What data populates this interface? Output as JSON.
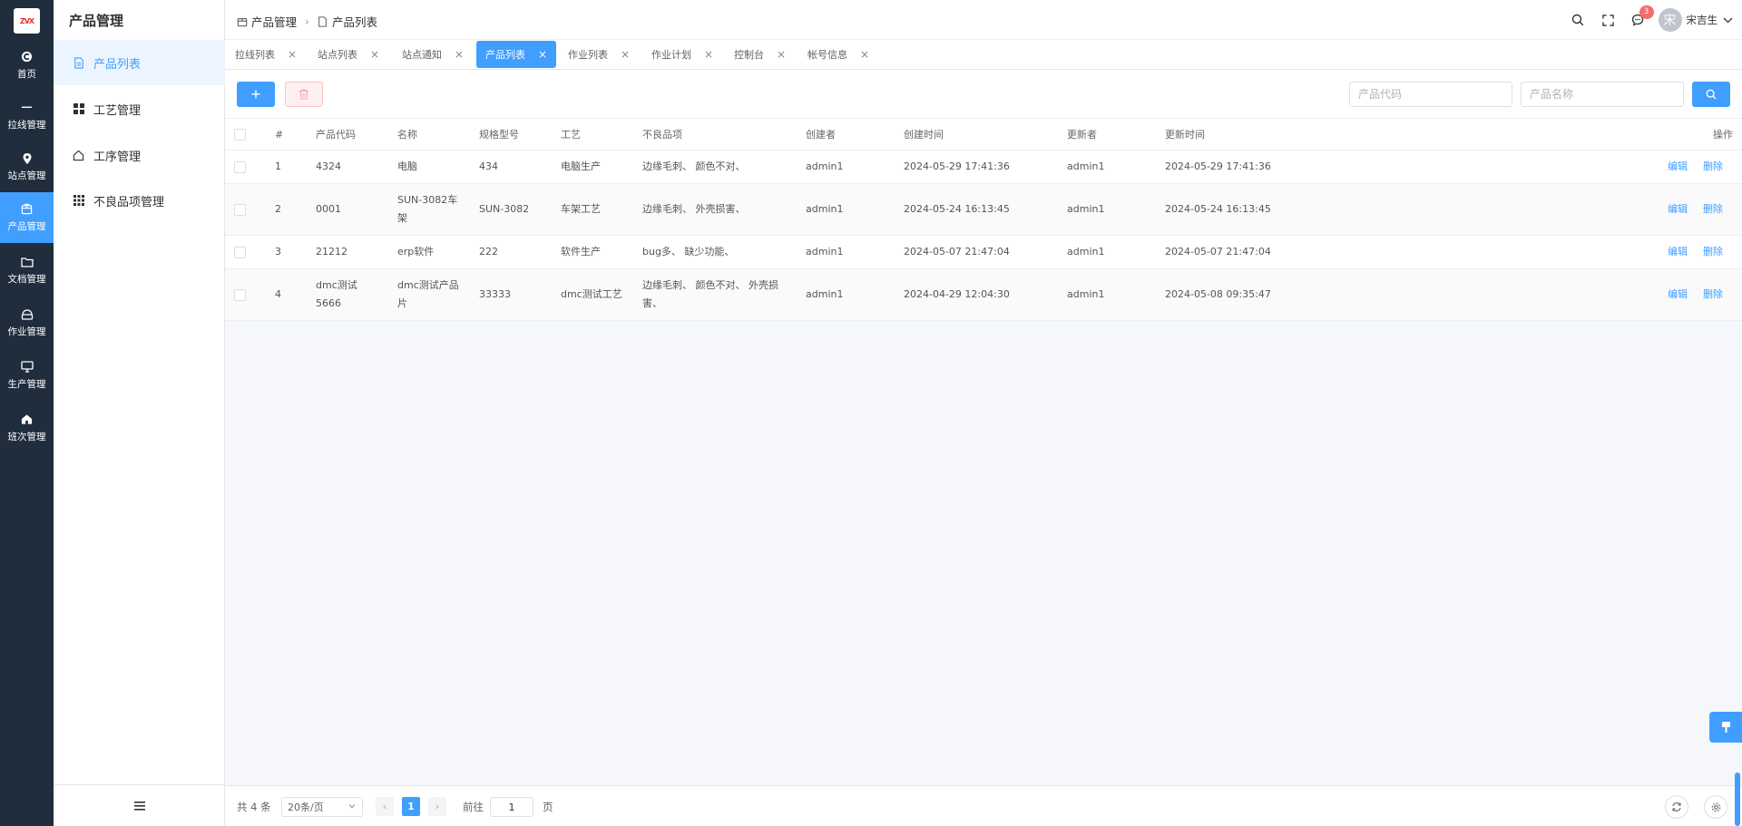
{
  "app": {
    "logo_text": "ZVX"
  },
  "rail": [
    {
      "label": "首页",
      "icon": "home-circle-icon"
    },
    {
      "label": "拉线管理",
      "icon": "line-icon"
    },
    {
      "label": "站点管理",
      "icon": "location-pin-icon"
    },
    {
      "label": "产品管理",
      "icon": "box-icon",
      "active": true
    },
    {
      "label": "文档管理",
      "icon": "folder-icon"
    },
    {
      "label": "作业管理",
      "icon": "briefcase-icon"
    },
    {
      "label": "生产管理",
      "icon": "monitor-icon"
    },
    {
      "label": "班次管理",
      "icon": "house-icon"
    }
  ],
  "sidebar": {
    "title": "产品管理",
    "items": [
      {
        "label": "产品列表",
        "icon": "document-icon",
        "active": true
      },
      {
        "label": "工艺管理",
        "icon": "grid-icon"
      },
      {
        "label": "工序管理",
        "icon": "home-outline-icon"
      },
      {
        "label": "不良品项管理",
        "icon": "dots-grid-icon"
      }
    ]
  },
  "header": {
    "breadcrumb": [
      "产品管理",
      "产品列表"
    ],
    "notify_count": "3",
    "user_initial": "宋",
    "user_name": "宋吉生"
  },
  "tabs": [
    {
      "label": "拉线列表"
    },
    {
      "label": "站点列表"
    },
    {
      "label": "站点通知"
    },
    {
      "label": "产品列表",
      "active": true
    },
    {
      "label": "作业列表"
    },
    {
      "label": "作业计划"
    },
    {
      "label": "控制台"
    },
    {
      "label": "帐号信息"
    }
  ],
  "toolbar": {
    "add_label": "+",
    "code_placeholder": "产品代码",
    "name_placeholder": "产品名称"
  },
  "table": {
    "headers": {
      "index": "#",
      "code": "产品代码",
      "name": "名称",
      "spec": "规格型号",
      "craft": "工艺",
      "defects": "不良品项",
      "creator": "创建者",
      "created": "创建时间",
      "updater": "更新者",
      "updated": "更新时间",
      "ops": "操作"
    },
    "rows": [
      {
        "index": "1",
        "code": "4324",
        "name": "电脑",
        "spec": "434",
        "craft": "电脑生产",
        "defects": "边缘毛刺、 颜色不对、",
        "creator": "admin1",
        "created": "2024-05-29 17:41:36",
        "updater": "admin1",
        "updated": "2024-05-29 17:41:36"
      },
      {
        "index": "2",
        "code": "0001",
        "name": "SUN-3082车架",
        "spec": "SUN-3082",
        "craft": "车架工艺",
        "defects": "边缘毛刺、 外壳损害、",
        "creator": "admin1",
        "created": "2024-05-24 16:13:45",
        "updater": "admin1",
        "updated": "2024-05-24 16:13:45"
      },
      {
        "index": "3",
        "code": "21212",
        "name": "erp软件",
        "spec": "222",
        "craft": "软件生产",
        "defects": "bug多、 缺少功能、",
        "creator": "admin1",
        "created": "2024-05-07 21:47:04",
        "updater": "admin1",
        "updated": "2024-05-07 21:47:04"
      },
      {
        "index": "4",
        "code": "dmc测试5666",
        "name": "dmc测试产品片",
        "spec": "33333",
        "craft": "dmc测试工艺",
        "defects": "边缘毛刺、 颜色不对、 外壳损害、",
        "creator": "admin1",
        "created": "2024-04-29 12:04:30",
        "updater": "admin1",
        "updated": "2024-05-08 09:35:47"
      }
    ],
    "edit_label": "编辑",
    "delete_label": "删除"
  },
  "pagination": {
    "total_text": "共 4 条",
    "page_size": "20条/页",
    "current_page": "1",
    "goto_label": "前往",
    "goto_value": "1",
    "page_unit": "页"
  },
  "colors": {
    "primary": "#409eff",
    "rail_bg": "#1f2d3d",
    "danger": "#f56c6c"
  }
}
